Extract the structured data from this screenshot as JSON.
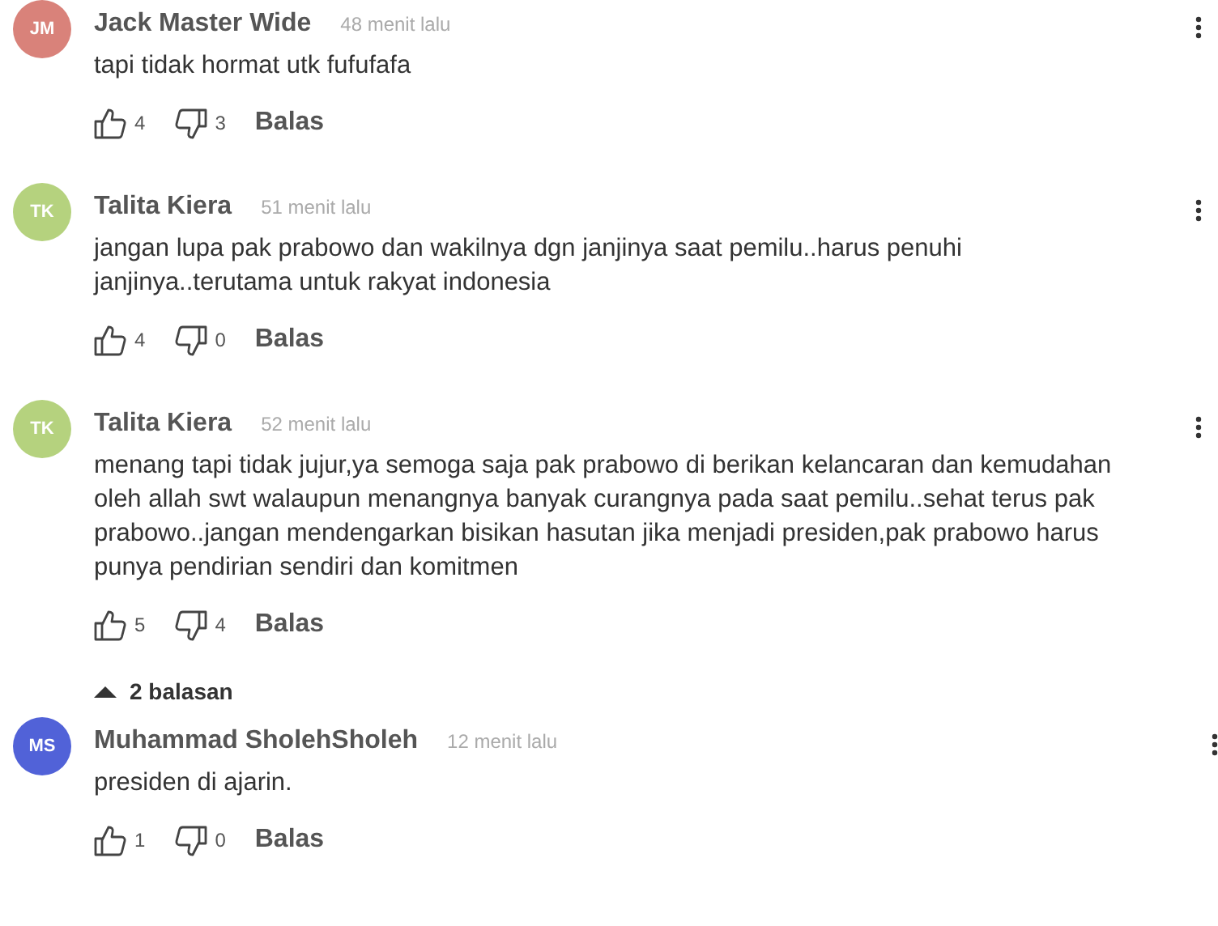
{
  "comments": [
    {
      "initials": "JM",
      "color": "#d9827a",
      "author": "Jack Master Wide",
      "time": "48 menit lalu",
      "text": "tapi tidak hormat utk fufufafa",
      "likes": "4",
      "dislikes": "3",
      "reply_label": "Balas"
    },
    {
      "initials": "TK",
      "color": "#b5d27e",
      "author": "Talita Kiera",
      "time": "51 menit lalu",
      "text": "jangan lupa pak prabowo dan wakilnya dgn janjinya saat pemilu..harus penuhi janjinya..terutama untuk rakyat indonesia",
      "likes": "4",
      "dislikes": "0",
      "reply_label": "Balas"
    },
    {
      "initials": "TK",
      "color": "#b5d27e",
      "author": "Talita Kiera",
      "time": "52 menit lalu",
      "text": "menang tapi tidak jujur,ya semoga saja pak prabowo di berikan kelancaran dan kemudahan oleh allah swt walaupun menangnya banyak curangnya pada saat pemilu..sehat terus pak prabowo..jangan mendengarkan bisikan hasutan jika menjadi presiden,pak prabowo harus punya pendirian sendiri dan komitmen",
      "likes": "5",
      "dislikes": "4",
      "reply_label": "Balas",
      "replies_toggle": {
        "label": "2 balasan",
        "expanded": true
      },
      "replies": [
        {
          "initials": "MS",
          "color": "#5162d8",
          "author": "Muhammad SholehSholeh",
          "time": "12 menit lalu",
          "text": "presiden di ajarin.",
          "likes": "1",
          "dislikes": "0",
          "reply_label": "Balas"
        }
      ]
    }
  ]
}
